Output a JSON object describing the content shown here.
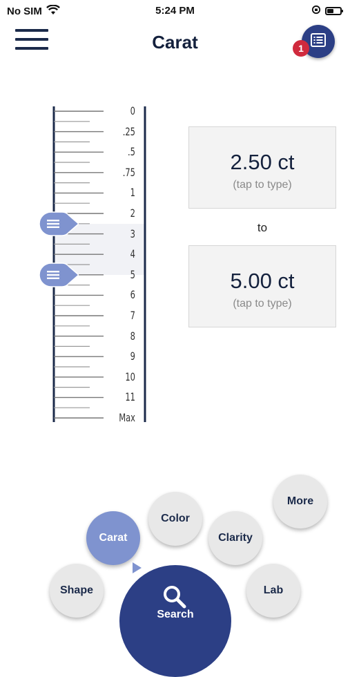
{
  "status_bar": {
    "carrier": "No SIM",
    "time": "5:24 PM"
  },
  "header": {
    "title": "Carat",
    "notification_count": "1"
  },
  "ruler": {
    "ticks": [
      "0",
      ".25",
      ".5",
      ".75",
      "1",
      "2",
      "3",
      "4",
      "5",
      "6",
      "7",
      "8",
      "9",
      "10",
      "11",
      "Max"
    ],
    "selected_from_index": 5.5,
    "selected_to_index": 8.0
  },
  "range": {
    "from_value": "2.50 ct",
    "from_hint": "(tap to type)",
    "separator": "to",
    "to_value": "5.00 ct",
    "to_hint": "(tap to type)"
  },
  "filters": {
    "shape": "Shape",
    "carat": "Carat",
    "color": "Color",
    "clarity": "Clarity",
    "more": "More",
    "lab": "Lab",
    "search": "Search"
  },
  "colors": {
    "primary": "#2c3f85",
    "active": "#7f93cf",
    "badge": "#d02a3d"
  }
}
